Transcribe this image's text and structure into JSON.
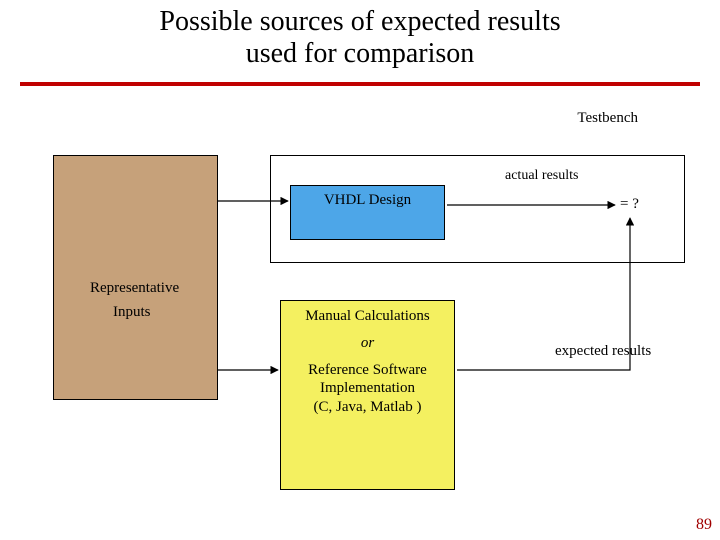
{
  "title_line1": "Possible sources of expected results",
  "title_line2": "used for comparison",
  "labels": {
    "testbench": "Testbench",
    "actual_results": "actual results",
    "vhdl_design": "VHDL Design",
    "eq_question": "= ?",
    "representative": "Representative",
    "inputs": "Inputs",
    "manual_calc": "Manual Calculations",
    "or": "or",
    "ref_sw1": "Reference Software",
    "ref_sw2": "Implementation",
    "ref_sw3": "(C, Java, Matlab )",
    "expected_results": "expected results"
  },
  "page_number": "89",
  "colors": {
    "rule": "#c00000",
    "inputs_fill": "#c6a17a",
    "vhdl_fill": "#4da6e8",
    "ref_fill": "#f4f060"
  }
}
